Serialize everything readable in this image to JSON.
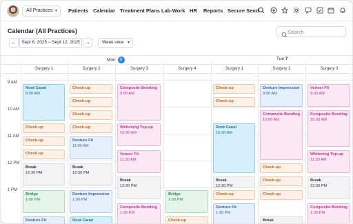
{
  "nav": {
    "practice_select": "All Practices",
    "links": [
      "Patients",
      "Calendar",
      "Treatment Plans",
      "Lab-Work",
      "HR",
      "Reports",
      "Secure Send"
    ]
  },
  "page": {
    "title": "Calendar (All Practices)",
    "search_placeholder": "Search",
    "date_range": "Sept 6, 2025 – Sept 12, 2025",
    "view": "Week view"
  },
  "days": [
    {
      "label": "Mon",
      "date": "6"
    },
    {
      "label": "Tue",
      "date": "7"
    }
  ],
  "surgeries": [
    "Surgery 1",
    "Surgery 2",
    "Surgery 3",
    "Surgery 4",
    "Surgery 1",
    "Surgery 2",
    "Surgery 3"
  ],
  "times": [
    "9 AM",
    "10 AM",
    "11 AM",
    "12 PM",
    "1 PM"
  ],
  "colors": {
    "accent": "#1e88f0",
    "root_canal_bg": "#d5effb",
    "root_canal_border": "#8fd0ef",
    "root_canal_text": "#1f6fa8",
    "checkup_bg": "#fdf0e6",
    "checkup_border": "#f3c9a4",
    "checkup_text": "#c0621b",
    "bonding_bg": "#fce8f4",
    "bonding_border": "#f1b3d9",
    "bonding_text": "#c2338e",
    "denture_bg": "#e6effc",
    "denture_border": "#b2c9f0",
    "denture_text": "#3a5fb5",
    "break_bg": "#f3f3f4",
    "break_border": "#dcdde0",
    "break_text": "#2f333b",
    "bridge_bg": "#e4f6e9",
    "bridge_border": "#a6dcb5",
    "bridge_text": "#2a8a47"
  },
  "appointments": [
    {
      "col": 0,
      "title": "Root Canal",
      "time": "9:00 AM",
      "type": "root_canal"
    },
    {
      "col": 0,
      "title": "Check-up",
      "time": "",
      "type": "checkup"
    },
    {
      "col": 0,
      "title": "Check-up",
      "time": "",
      "type": "checkup"
    },
    {
      "col": 0,
      "title": "Check-up",
      "time": "",
      "type": "checkup"
    },
    {
      "col": 0,
      "title": "Break",
      "time": "12:30 PM",
      "type": "break"
    },
    {
      "col": 0,
      "title": "Bridge",
      "time": "1:00 PM",
      "type": "bridge"
    },
    {
      "col": 0,
      "title": "Denture Fit",
      "time": "",
      "type": "denture"
    },
    {
      "col": 1,
      "title": "Check-up",
      "time": "",
      "type": "checkup"
    },
    {
      "col": 1,
      "title": "Check-up",
      "time": "",
      "type": "checkup"
    },
    {
      "col": 1,
      "title": "Check-up",
      "time": "",
      "type": "checkup"
    },
    {
      "col": 1,
      "title": "Check-up",
      "time": "",
      "type": "checkup"
    },
    {
      "col": 1,
      "title": "Denture Fit",
      "time": "11:00 AM",
      "type": "denture"
    },
    {
      "col": 1,
      "title": "Break",
      "time": "12:30 PM",
      "type": "break"
    },
    {
      "col": 1,
      "title": "Denture Impression",
      "time": "1:00 PM",
      "type": "denture"
    },
    {
      "col": 1,
      "title": "Root Canal",
      "time": "",
      "type": "root_canal"
    },
    {
      "col": 2,
      "title": "Composite Bonding",
      "time": "9:00 AM",
      "type": "bonding"
    },
    {
      "col": 2,
      "title": "Whitening Top-up",
      "time": "10:30 AM",
      "type": "bonding"
    },
    {
      "col": 2,
      "title": "Veneer Fit",
      "time": "11:30 AM",
      "type": "bonding"
    },
    {
      "col": 2,
      "title": "Break",
      "time": "12:30 PM",
      "type": "break"
    },
    {
      "col": 2,
      "title": "Composite Bonding",
      "time": "1:30 PM",
      "type": "bonding"
    },
    {
      "col": 3,
      "title": "Bridge",
      "time": "1:00 PM",
      "type": "bridge"
    },
    {
      "col": 3,
      "title": "Check-up",
      "time": "",
      "type": "checkup"
    },
    {
      "col": 4,
      "title": "Check-up",
      "time": "",
      "type": "checkup"
    },
    {
      "col": 4,
      "title": "Check-up",
      "time": "",
      "type": "checkup"
    },
    {
      "col": 4,
      "title": "Root Canal",
      "time": "10:30 AM",
      "type": "root_canal"
    },
    {
      "col": 4,
      "title": "Break",
      "time": "12:30 PM",
      "type": "break"
    },
    {
      "col": 4,
      "title": "Check-up",
      "time": "",
      "type": "checkup"
    },
    {
      "col": 4,
      "title": "Denture Fit",
      "time": "1:30 PM",
      "type": "denture"
    },
    {
      "col": 5,
      "title": "Denture Impression",
      "time": "9:00 AM",
      "type": "denture"
    },
    {
      "col": 5,
      "title": "Composite Bonding",
      "time": "10:00 AM",
      "type": "bonding"
    },
    {
      "col": 5,
      "title": "Check-up",
      "time": "",
      "type": "checkup"
    },
    {
      "col": 5,
      "title": "Check-up",
      "time": "",
      "type": "checkup"
    },
    {
      "col": 5,
      "title": "Check-up",
      "time": "",
      "type": "checkup"
    },
    {
      "col": 5,
      "title": "Break",
      "time": "",
      "type": "break"
    },
    {
      "col": 6,
      "title": "Veneer Fit",
      "time": "9:00 AM",
      "type": "bonding"
    },
    {
      "col": 6,
      "title": "Composite Bonding",
      "time": "10:00 AM",
      "type": "bonding"
    },
    {
      "col": 6,
      "title": "Whitening Top-up",
      "time": "11:30 AM",
      "type": "bonding"
    },
    {
      "col": 6,
      "title": "Break",
      "time": "12:30 PM",
      "type": "break"
    },
    {
      "col": 6,
      "title": "Composite Bonding",
      "time": "1:30 PM",
      "type": "bonding"
    }
  ]
}
